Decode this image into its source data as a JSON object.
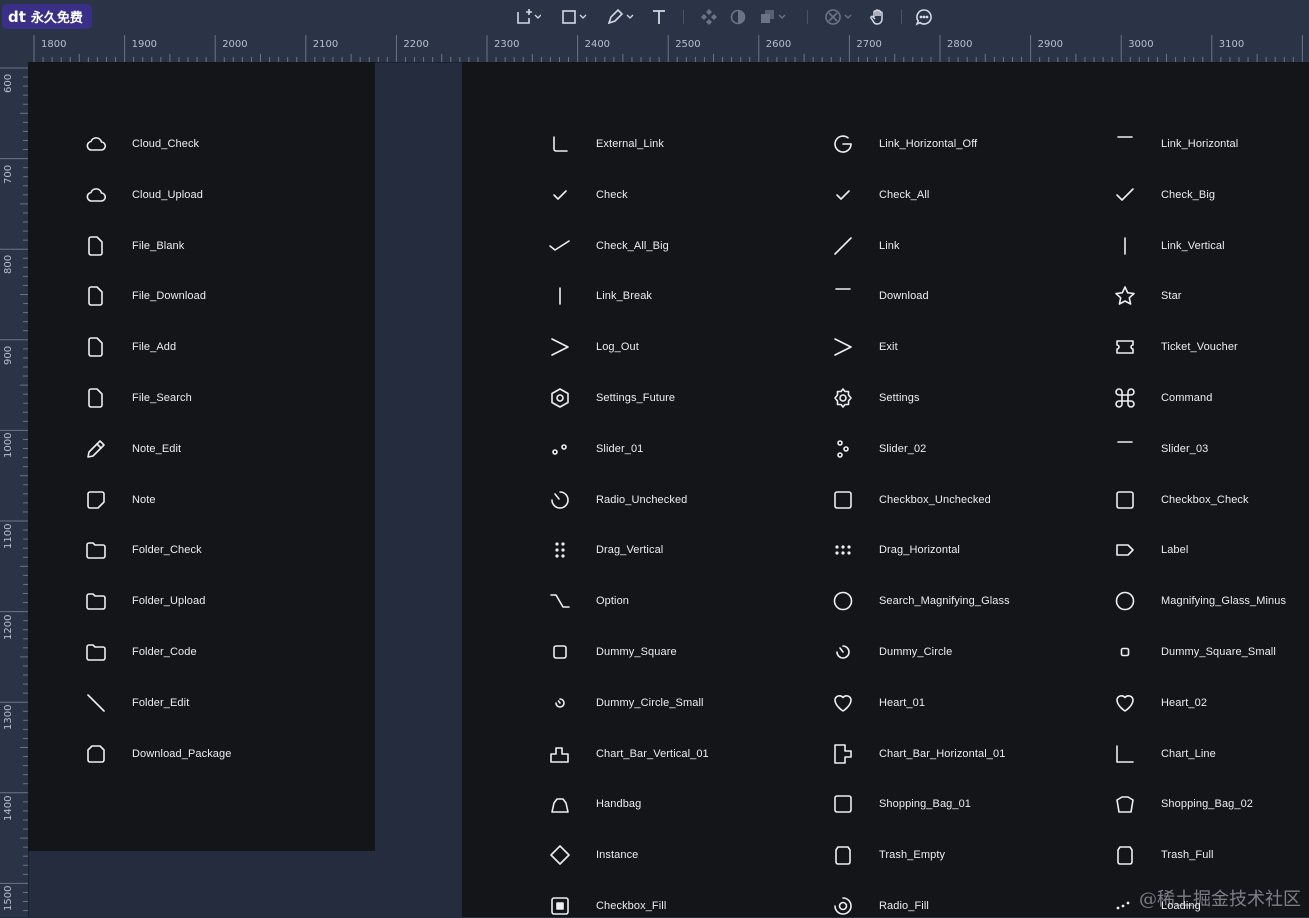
{
  "toolbar": {
    "brand_mark": "dt",
    "brand_text": "永久免费",
    "tools": [
      {
        "name": "frame-tool-icon"
      },
      {
        "name": "shape-tool-icon"
      },
      {
        "name": "pen-tool-icon"
      },
      {
        "name": "text-tool-icon"
      },
      {
        "name": "component-tool-icon"
      },
      {
        "name": "mask-tool-icon"
      },
      {
        "name": "boolean-tool-icon"
      },
      {
        "name": "plugin-tool-icon"
      },
      {
        "name": "hand-tool-icon"
      },
      {
        "name": "comment-tool-icon"
      }
    ]
  },
  "ruler_h": [
    "1800",
    "1900",
    "2000",
    "2100",
    "2200",
    "2300",
    "2400",
    "2500",
    "2600",
    "2700",
    "2800",
    "2900",
    "3000",
    "3100"
  ],
  "ruler_v": [
    "600",
    "700",
    "800",
    "900",
    "1000",
    "1100",
    "1200",
    "1300",
    "1400",
    "1500"
  ],
  "left_frame": {
    "items": [
      {
        "label": "Cloud_Check",
        "icon": "cloud-icon"
      },
      {
        "label": "Cloud_Upload",
        "icon": "cloud-icon"
      },
      {
        "label": "File_Blank",
        "icon": "file-icon"
      },
      {
        "label": "File_Download",
        "icon": "file-icon"
      },
      {
        "label": "File_Add",
        "icon": "file-icon"
      },
      {
        "label": "File_Search",
        "icon": "file-icon"
      },
      {
        "label": "Note_Edit",
        "icon": "pencil-icon"
      },
      {
        "label": "Note",
        "icon": "note-icon"
      },
      {
        "label": "Folder_Check",
        "icon": "folder-icon"
      },
      {
        "label": "Folder_Upload",
        "icon": "folder-icon"
      },
      {
        "label": "Folder_Code",
        "icon": "folder-icon"
      },
      {
        "label": "Folder_Edit",
        "icon": "diagonal-line-icon"
      },
      {
        "label": "Download_Package",
        "icon": "package-icon"
      }
    ]
  },
  "right_frame": {
    "columns": [
      [
        {
          "label": "External_Link",
          "icon": "external-link-icon"
        },
        {
          "label": "Check",
          "icon": "check-icon"
        },
        {
          "label": "Check_All_Big",
          "icon": "check-all-big-icon"
        },
        {
          "label": "Link_Break",
          "icon": "vertical-line-icon"
        },
        {
          "label": "Log_Out",
          "icon": "chevron-right-icon"
        },
        {
          "label": "Settings_Future",
          "icon": "hexagon-icon"
        },
        {
          "label": "Slider_01",
          "icon": "slider-01-icon"
        },
        {
          "label": "Radio_Unchecked",
          "icon": "radio-partial-icon"
        },
        {
          "label": "Drag_Vertical",
          "icon": "drag-vertical-icon"
        },
        {
          "label": "Option",
          "icon": "option-icon"
        },
        {
          "label": "Dummy_Square",
          "icon": "square-icon"
        },
        {
          "label": "Dummy_Circle_Small",
          "icon": "circle-small-icon"
        },
        {
          "label": "Chart_Bar_Vertical_01",
          "icon": "chart-bar-vertical-icon"
        },
        {
          "label": "Handbag",
          "icon": "handbag-icon"
        },
        {
          "label": "Instance",
          "icon": "diamond-icon"
        },
        {
          "label": "Checkbox_Fill",
          "icon": "checkbox-fill-icon"
        }
      ],
      [
        {
          "label": "Link_Horizontal_Off",
          "icon": "link-off-icon"
        },
        {
          "label": "Check_All",
          "icon": "check-icon"
        },
        {
          "label": "Link",
          "icon": "slash-icon"
        },
        {
          "label": "Download",
          "icon": "dash-icon"
        },
        {
          "label": "Exit",
          "icon": "chevron-right-icon"
        },
        {
          "label": "Settings",
          "icon": "gear-icon"
        },
        {
          "label": "Slider_02",
          "icon": "slider-02-icon"
        },
        {
          "label": "Checkbox_Unchecked",
          "icon": "checkbox-icon"
        },
        {
          "label": "Drag_Horizontal",
          "icon": "drag-horizontal-icon"
        },
        {
          "label": "Search_Magnifying_Glass",
          "icon": "circle-icon"
        },
        {
          "label": "Dummy_Circle",
          "icon": "circle-partial-icon"
        },
        {
          "label": "Heart_01",
          "icon": "heart-icon"
        },
        {
          "label": "Chart_Bar_Horizontal_01",
          "icon": "chart-bar-horizontal-icon"
        },
        {
          "label": "Shopping_Bag_01",
          "icon": "checkbox-icon"
        },
        {
          "label": "Trash_Empty",
          "icon": "trash-icon"
        },
        {
          "label": "Radio_Fill",
          "icon": "radio-fill-icon"
        }
      ],
      [
        {
          "label": "Link_Horizontal",
          "icon": "dash-icon"
        },
        {
          "label": "Check_Big",
          "icon": "check-big-icon"
        },
        {
          "label": "Link_Vertical",
          "icon": "vertical-line-icon"
        },
        {
          "label": "Star",
          "icon": "star-icon"
        },
        {
          "label": "Ticket_Voucher",
          "icon": "ticket-icon"
        },
        {
          "label": "Command",
          "icon": "command-icon"
        },
        {
          "label": "Slider_03",
          "icon": "dash-icon"
        },
        {
          "label": "Checkbox_Check",
          "icon": "checkbox-icon"
        },
        {
          "label": "Label",
          "icon": "label-icon"
        },
        {
          "label": "Magnifying_Glass_Minus",
          "icon": "circle-icon"
        },
        {
          "label": "Dummy_Square_Small",
          "icon": "square-small-icon"
        },
        {
          "label": "Heart_02",
          "icon": "heart-icon"
        },
        {
          "label": "Chart_Line",
          "icon": "chart-line-icon"
        },
        {
          "label": "Shopping_Bag_02",
          "icon": "shopping-bag-icon"
        },
        {
          "label": "Trash_Full",
          "icon": "trash-icon"
        },
        {
          "label": "Loading",
          "icon": "loading-icon"
        }
      ]
    ]
  },
  "watermark": "@稀土掘金技术社区",
  "colors": {
    "canvas": "#242c3d",
    "frame": "#131519",
    "toolbar": "#2b3447",
    "brand": "#3a2f86",
    "text": "#eceef2"
  }
}
